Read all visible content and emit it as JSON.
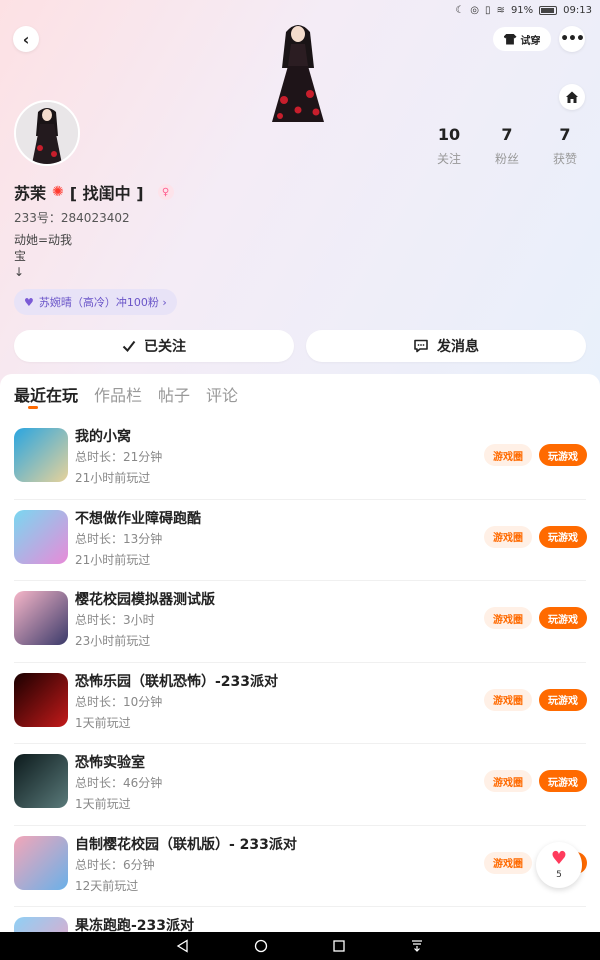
{
  "status_bar": {
    "battery": "91%",
    "time": "09:13"
  },
  "header": {
    "try_on_label": "试穿"
  },
  "profile": {
    "stats": [
      {
        "num": "10",
        "label": "关注"
      },
      {
        "num": "7",
        "label": "粉丝"
      },
      {
        "num": "7",
        "label": "获赞"
      }
    ],
    "name": "苏茉",
    "name_suffix": "[ 找闺中 ]",
    "id_text": "233号：284023402",
    "bio": "动她=动我\n宝\n↓",
    "fan_badge": "苏婉晴（高冷）冲100粉 ›",
    "follow_label": "已关注",
    "message_label": "发消息"
  },
  "tabs": [
    "最近在玩",
    "作品栏",
    "帖子",
    "评论"
  ],
  "buttons": {
    "circle": "游戏圈",
    "play": "玩游戏"
  },
  "games": [
    {
      "title": "我的小窝",
      "duration": "总时长：21分钟",
      "last": "21小时前玩过",
      "colors": [
        "#2aa5e0",
        "#e7d29a"
      ]
    },
    {
      "title": "不想做作业障碍跑酷",
      "duration": "总时长：13分钟",
      "last": "21小时前玩过",
      "colors": [
        "#7ad7f0",
        "#e88ad8"
      ]
    },
    {
      "title": "樱花校园模拟器测试版",
      "duration": "总时长：3小时",
      "last": "23小时前玩过",
      "colors": [
        "#f6b6c8",
        "#3a3a6a"
      ]
    },
    {
      "title": "恐怖乐园（联机恐怖）-233派对",
      "duration": "总时长：10分钟",
      "last": "1天前玩过",
      "colors": [
        "#1a0000",
        "#c41a1a"
      ]
    },
    {
      "title": "恐怖实验室",
      "duration": "总时长：46分钟",
      "last": "1天前玩过",
      "colors": [
        "#0c1a1c",
        "#5a7a7a"
      ]
    },
    {
      "title": "自制樱花校园（联机版）- 233派对",
      "duration": "总时长：6分钟",
      "last": "12天前玩过",
      "colors": [
        "#f3a6b8",
        "#6ab0e8"
      ]
    },
    {
      "title": "果冻跑跑-233派对",
      "duration": "",
      "last": "",
      "colors": [
        "#8fd0f5",
        "#f5a0c0"
      ]
    }
  ],
  "like": {
    "count": "5"
  }
}
